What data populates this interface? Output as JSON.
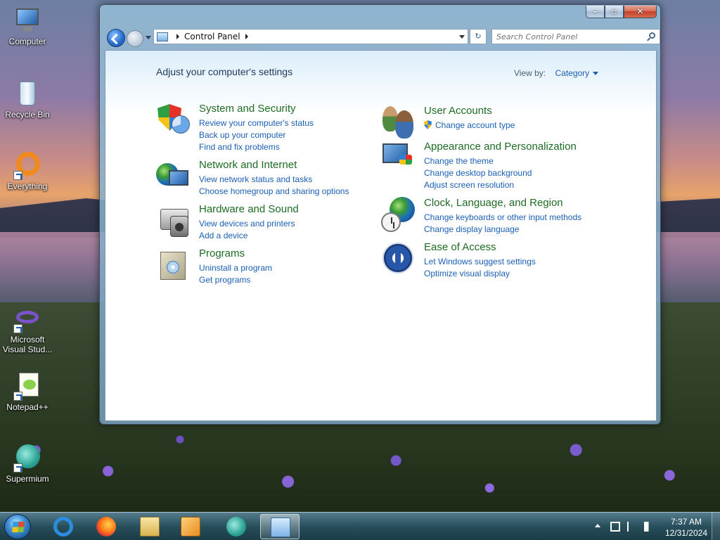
{
  "desktop": {
    "icons": [
      {
        "label": "Computer"
      },
      {
        "label": "Recycle Bin"
      },
      {
        "label": "Everything"
      },
      {
        "label": "Microsoft Visual Stud..."
      },
      {
        "label": "Notepad++"
      },
      {
        "label": "Supermium"
      }
    ]
  },
  "window": {
    "address": {
      "root_icon": "control-panel-icon",
      "crumb": "Control Panel"
    },
    "search": {
      "placeholder": "Search Control Panel"
    },
    "headline": "Adjust your computer's settings",
    "view_by": {
      "label": "View by:",
      "value": "Category"
    },
    "left_categories": [
      {
        "title": "System and Security",
        "icon": "security-shield-icon",
        "links": [
          "Review your computer's status",
          "Back up your computer",
          "Find and fix problems"
        ]
      },
      {
        "title": "Network and Internet",
        "icon": "network-globe-icon",
        "links": [
          "View network status and tasks",
          "Choose homegroup and sharing options"
        ]
      },
      {
        "title": "Hardware and Sound",
        "icon": "printer-speaker-icon",
        "links": [
          "View devices and printers",
          "Add a device"
        ]
      },
      {
        "title": "Programs",
        "icon": "programs-box-icon",
        "links": [
          "Uninstall a program",
          "Get programs"
        ]
      }
    ],
    "right_categories": [
      {
        "title": "User Accounts",
        "icon": "users-icon",
        "links": [
          "Change account type"
        ]
      },
      {
        "title": "Appearance and Personalization",
        "icon": "display-paint-icon",
        "links": [
          "Change the theme",
          "Change desktop background",
          "Adjust screen resolution"
        ]
      },
      {
        "title": "Clock, Language, and Region",
        "icon": "globe-clock-icon",
        "links": [
          "Change keyboards or other input methods",
          "Change display language"
        ]
      },
      {
        "title": "Ease of Access",
        "icon": "ease-of-access-icon",
        "links": [
          "Let Windows suggest settings",
          "Optimize visual display"
        ]
      }
    ]
  },
  "taskbar": {
    "apps": [
      "internet-explorer-icon",
      "firefox-icon",
      "file-explorer-icon",
      "media-player-icon",
      "supermium-icon",
      "control-panel-icon"
    ],
    "time": "7:37 AM",
    "date": "12/31/2024"
  },
  "colors": {
    "category_title": "#1e6c23",
    "link": "#1a5fb4",
    "headline": "#1e395b"
  }
}
